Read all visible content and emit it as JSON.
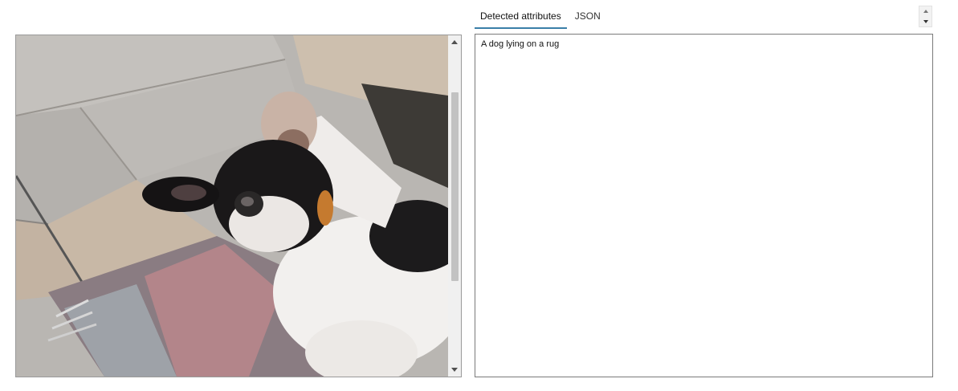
{
  "tabs": [
    {
      "label": "Detected attributes",
      "active": true
    },
    {
      "label": "JSON",
      "active": false
    }
  ],
  "result": {
    "text": "A dog lying on a rug"
  },
  "image_panel": {
    "scroll_up_icon": "triangle-up",
    "scroll_down_icon": "triangle-down"
  },
  "spin_control": {
    "up_icon": "triangle-up",
    "down_icon": "triangle-down"
  },
  "colors": {
    "tab_underline": "#3a7fa8",
    "scrollbar_track": "#f0f0f0",
    "scrollbar_thumb": "#c2c2c2"
  }
}
